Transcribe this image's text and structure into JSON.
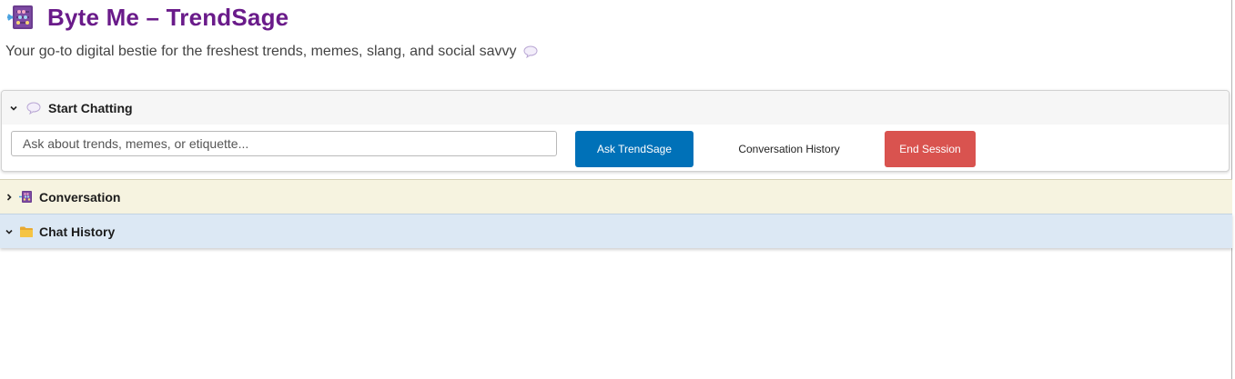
{
  "app": {
    "title": "Byte Me – TrendSage",
    "tagline": "Your go-to digital bestie for the freshest trends, memes, slang, and social savvy"
  },
  "icons": {
    "title_icon": "abacus-icon",
    "tagline_icon": "speech-bubble-icon",
    "start_icon": "speech-bubble-icon",
    "conversation_icon": "abacus-icon",
    "history_icon": "folder-icon"
  },
  "start_panel": {
    "label": "Start Chatting",
    "expanded": true,
    "input_placeholder": "Ask about trends, memes, or etiquette...",
    "input_value": "",
    "ask_button": "Ask TrendSage",
    "history_button": "Conversation History",
    "end_button": "End Session"
  },
  "conversation_panel": {
    "label": "Conversation",
    "expanded": false
  },
  "history_panel": {
    "label": "Chat History",
    "expanded": true
  },
  "colors": {
    "title": "#6a1b8a",
    "ask_button": "#0071b8",
    "end_button": "#d9534f",
    "conversation_header": "#f6f3e0",
    "history_header": "#dce8f4"
  }
}
